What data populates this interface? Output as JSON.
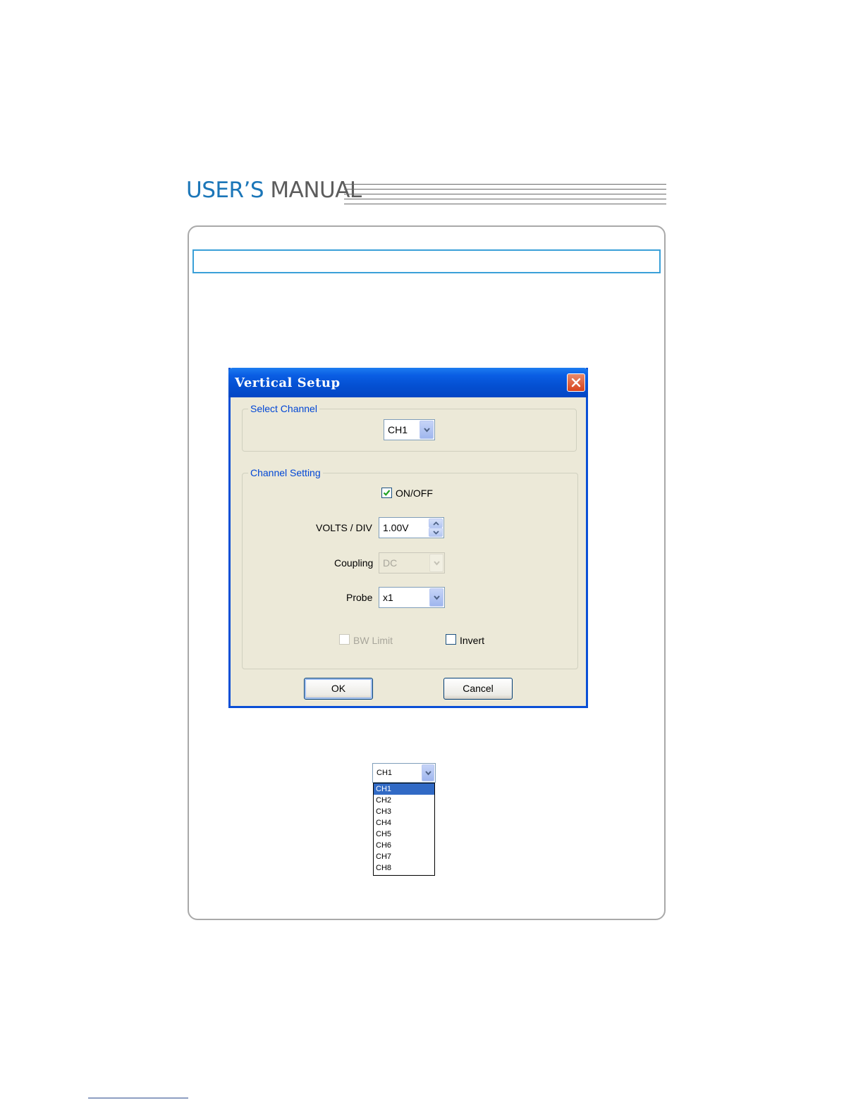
{
  "header": {
    "title_part1": "USER’S",
    "title_part2": "MANUAL"
  },
  "dialog": {
    "title": "Vertical Setup",
    "select_channel": {
      "group_label": "Select Channel",
      "value": "CH1"
    },
    "channel_setting": {
      "group_label": "Channel Setting",
      "onoff_label": "ON/OFF",
      "onoff_checked": true,
      "volts_label": "VOLTS / DIV",
      "volts_value": "1.00V",
      "coupling_label": "Coupling",
      "coupling_value": "DC",
      "probe_label": "Probe",
      "probe_value": "x1",
      "bw_limit_label": "BW Limit",
      "invert_label": "Invert"
    },
    "ok_label": "OK",
    "cancel_label": "Cancel"
  },
  "dropdown": {
    "value": "CH1",
    "options": [
      "CH1",
      "CH2",
      "CH3",
      "CH4",
      "CH5",
      "CH6",
      "CH7",
      "CH8"
    ],
    "selected": "CH1"
  },
  "colors": {
    "brand_blue": "#1b76b8",
    "titlebar_blue": "#0450d2",
    "selection_blue": "#316ac5"
  }
}
